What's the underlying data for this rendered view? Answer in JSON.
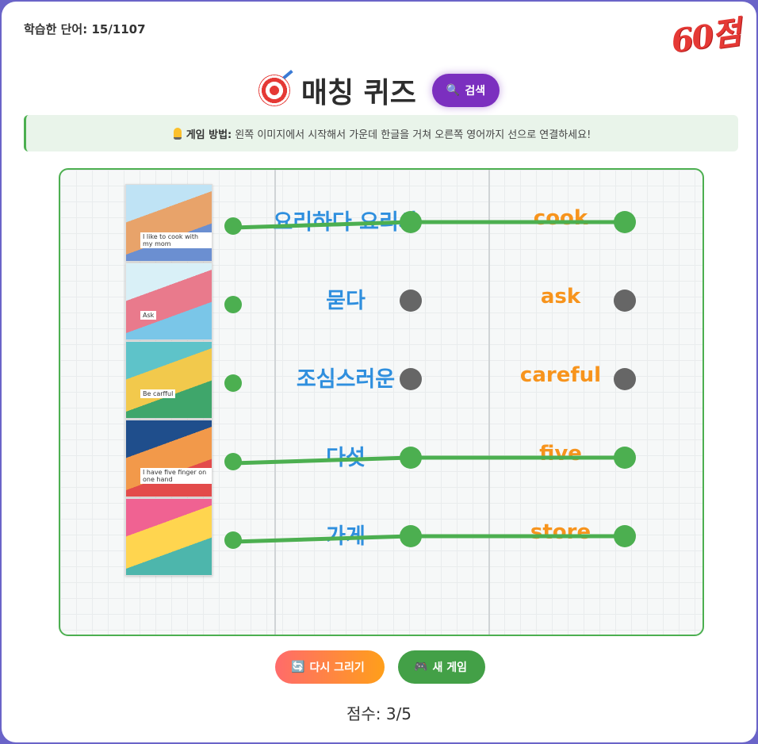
{
  "progress": {
    "label": "학습한 단어: 15/1107"
  },
  "stamp": {
    "score": "60점"
  },
  "header": {
    "title": "매칭 퀴즈",
    "search_label": "검색"
  },
  "guide": {
    "bold": "게임 방법:",
    "text": "왼쪽 이미지에서 시작해서 가운데 한글을 거쳐 오른쪽 영어까지 선으로 연결하세요!"
  },
  "rows": [
    {
      "korean": "요리하다 요리사",
      "english": "cook",
      "connected": true,
      "image_caption": "I like to cook with my mom",
      "image_colors": [
        "#bfe3f5",
        "#e8a36a",
        "#6b8fd1"
      ]
    },
    {
      "korean": "묻다",
      "english": "ask",
      "connected": false,
      "image_caption": "Ask",
      "image_colors": [
        "#d9f0f7",
        "#e97a8c",
        "#7ac6e8"
      ]
    },
    {
      "korean": "조심스러운",
      "english": "careful",
      "connected": false,
      "image_caption": "Be carfful",
      "image_colors": [
        "#5ec3c9",
        "#f2c94c",
        "#3fa66b"
      ]
    },
    {
      "korean": "다섯",
      "english": "five",
      "connected": true,
      "image_caption": "I have five finger on one hand",
      "image_colors": [
        "#1f4e8c",
        "#f2994a",
        "#e34b4b"
      ]
    },
    {
      "korean": "가게",
      "english": "store",
      "connected": true,
      "image_caption": "",
      "image_colors": [
        "#f06292",
        "#ffd54f",
        "#4db6ac"
      ]
    }
  ],
  "buttons": {
    "redraw": "다시 그리기",
    "new_game": "새 게임"
  },
  "score": {
    "label": "점수: 3/5"
  },
  "colors": {
    "korean_text": "#2f8fde",
    "english_text": "#f7941d",
    "connected_line": "#4caf50",
    "unconnected_dot": "#666666"
  }
}
